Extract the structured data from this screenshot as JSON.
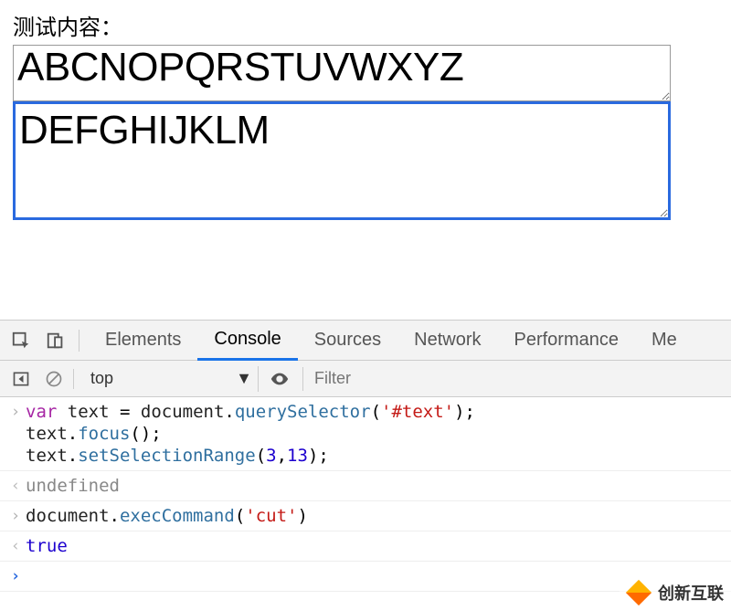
{
  "top": {
    "label": "测试内容：",
    "textarea1_value": "ABCNOPQRSTUVWXYZ",
    "textarea2_value": "DEFGHIJKLM"
  },
  "devtools": {
    "tabs": [
      "Elements",
      "Console",
      "Sources",
      "Network",
      "Performance",
      "Me"
    ],
    "active_tab_index": 1,
    "context": "top",
    "filter_placeholder": "Filter"
  },
  "console": {
    "lines": [
      {
        "type": "input",
        "code": "var text = document.querySelector('#text');\ntext.focus();\ntext.setSelectionRange(3,13);"
      },
      {
        "type": "output",
        "code": "undefined"
      },
      {
        "type": "input",
        "code": "document.execCommand('cut')"
      },
      {
        "type": "output",
        "code": "true"
      },
      {
        "type": "prompt",
        "code": ""
      }
    ]
  },
  "watermark": {
    "text": "创新互联"
  }
}
